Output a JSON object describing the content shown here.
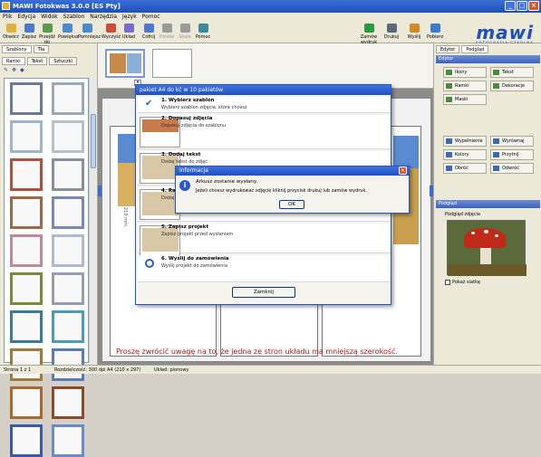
{
  "window": {
    "title": "MAWI Fotokwas 3.0.0 [ES Pty]"
  },
  "menu": [
    "Plik",
    "Edycja",
    "Widok",
    "Szablon",
    "Narzędzia",
    "Język",
    "Pomoc"
  ],
  "toolbar": {
    "items": [
      {
        "label": "Otwórz",
        "icon": "open-folder-icon",
        "disabled": false
      },
      {
        "label": "Zapisz",
        "icon": "save-icon",
        "disabled": false
      },
      {
        "label": "Przejdź do",
        "icon": "goto-icon",
        "disabled": false
      },
      {
        "label": "Powiększ",
        "icon": "zoom-in-icon",
        "disabled": false
      },
      {
        "label": "Pomniejsz",
        "icon": "zoom-out-icon",
        "disabled": false
      },
      {
        "label": "Wyczyść",
        "icon": "clear-icon",
        "disabled": false
      },
      {
        "label": "Układ",
        "icon": "layout-icon",
        "disabled": false
      },
      {
        "label": "Cofnij",
        "icon": "undo-icon",
        "disabled": false
      },
      {
        "label": "Ponów",
        "icon": "redo-icon",
        "disabled": true
      },
      {
        "label": "Skala",
        "icon": "scale-icon",
        "disabled": true
      },
      {
        "label": "Pomoc",
        "icon": "help-icon",
        "disabled": false
      }
    ],
    "right_items": [
      {
        "label": "Zamów wydruk",
        "icon": "order-print-icon"
      },
      {
        "label": "Drukuj",
        "icon": "print-icon"
      },
      {
        "label": "Wyślij",
        "icon": "send-icon"
      },
      {
        "label": "Pobierz",
        "icon": "download-icon"
      }
    ]
  },
  "logo": {
    "text": "mawi",
    "subtitle": "FOTOGRAFIA SZKOLNA",
    "color": "#1f4fb8"
  },
  "left_panel": {
    "tabs_top": [
      "Szablony",
      "Tła"
    ],
    "tabs_second": [
      "Ramki",
      "Tekst",
      "Sztuczki"
    ],
    "frame_colors": [
      "#6b7a96",
      "#9aa8b8",
      "#a0b4d0",
      "#b8c0c8",
      "#b05040",
      "#8a8f9a",
      "#9a6a4a",
      "#7888b8",
      "#c08a9a",
      "#b0b8d0",
      "#7a8a3a",
      "#9a9ab0",
      "#3a7a9a",
      "#4a9ab8",
      "#a07a3a",
      "#5a7ab8",
      "#a86a2a",
      "#8a4a2a",
      "#3a5aa8",
      "#6a8ac8"
    ]
  },
  "dialog": {
    "title": "pakiet A4 do kč w 10 pakietów",
    "steps": [
      {
        "title": "1. Wybierz szablon",
        "desc": "Wybierz szablon zdjęcia, które chcesz"
      },
      {
        "title": "2. Dopasuj zdjęcia",
        "desc": "Dopasuj zdjęcia do szablonu"
      },
      {
        "title": "3. Dodaj tekst",
        "desc": "Dodaj tekst do zdjęć"
      },
      {
        "title": "4. Ramki i dekoracje",
        "desc": "Dodaj ramki i dekoracje do zdjęć"
      },
      {
        "title": "5. Zapisz projekt",
        "desc": "Zapisz projekt przed wysłaniem"
      },
      {
        "title": "6. Wyślij do zamówienia",
        "desc": "Wyślij projekt do zamówienia"
      }
    ],
    "close_label": "Zamknij"
  },
  "info_dialog": {
    "title": "Informacja",
    "line1": "Arkusz zostanie wysłany.",
    "line2": "Jeżeli chcesz wydrukować zdjęcie kliknij przycisk drukuj lub zamów wydruk.",
    "ok_label": "OK"
  },
  "warning": "Proszę zwrócić uwagę na to, że jedna ze stron układu ma mniejszą szerokość.",
  "right_panel": {
    "tabs": [
      "Edytor",
      "Podgląd"
    ],
    "header": "Edytor",
    "buttons": [
      {
        "label": "Ikony",
        "col": 0
      },
      {
        "label": "Tekst",
        "col": 1
      },
      {
        "label": "Ramki",
        "col": 0
      },
      {
        "label": "Dekoracje",
        "col": 1
      },
      {
        "label": "Maski",
        "col": 0
      }
    ],
    "buttons2": [
      {
        "label": "Wypełnienie"
      },
      {
        "label": "Wyrównaj"
      },
      {
        "label": "Kolory"
      },
      {
        "label": "Przytnij"
      },
      {
        "label": "Obróć"
      },
      {
        "label": "Odwróć"
      }
    ],
    "preview_header": "Podgląd",
    "preview_caption": "Podgląd zdjęcia",
    "checkbox_label": "Pokaż siatkę"
  },
  "status": [
    "Strona 1 z 1",
    "Rozdzielczość: 300 dpi",
    "A4 (210 x 297)",
    "Układ: pionowy"
  ]
}
